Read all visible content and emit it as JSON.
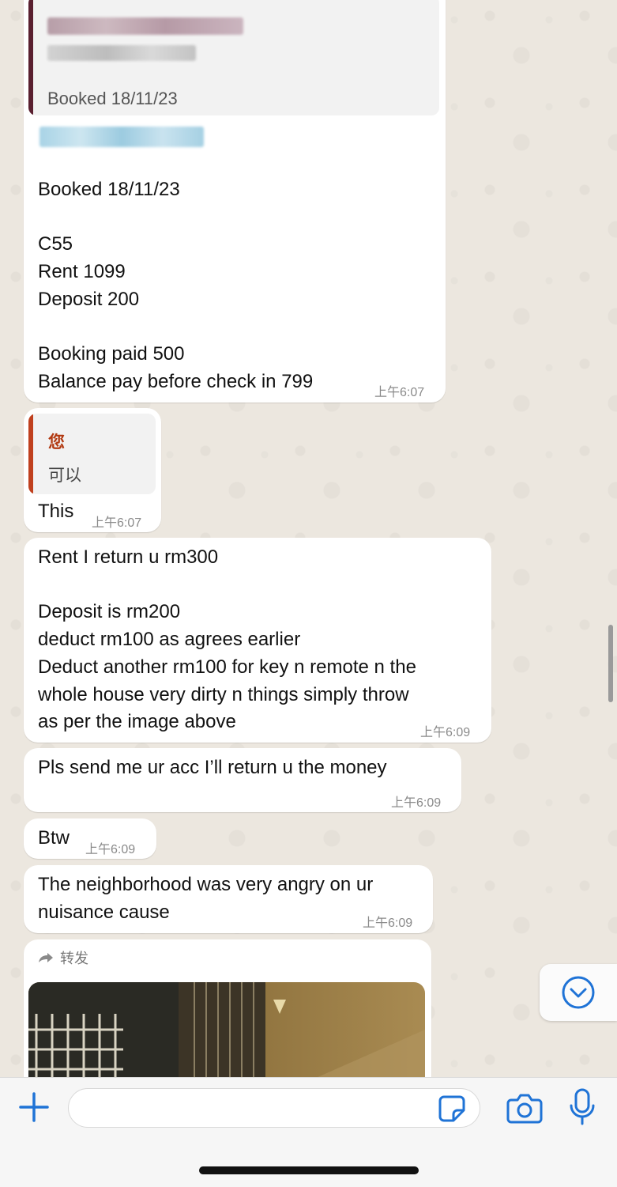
{
  "chat": {
    "messages": [
      {
        "quote": {
          "blurred_name": "▒▒▒▒▒▒ ▒▒▒▒▒",
          "blurred_line": "▒▒▒▒▒▒▒",
          "text": "Booked 18/11/23"
        },
        "blurred_header": "▒▒▒▒▒▒▒▒",
        "text": "Booked 18/11/23\n\nC55\nRent 1099\nDeposit 200\n\nBooking paid 500\nBalance pay before check in 799",
        "time": "上午6:07"
      },
      {
        "quote": {
          "author": "您",
          "text": "可以"
        },
        "text": "This",
        "time": "上午6:07"
      },
      {
        "text": "Rent I return u rm300\n\nDeposit is rm200\ndeduct rm100 as agrees earlier\nDeduct another rm100 for key n remote n the\nwhole house very dirty n things simply throw\nas per the image above",
        "time": "上午6:09"
      },
      {
        "text": "Pls send me ur acc I’ll return u the money",
        "time": "上午6:09"
      },
      {
        "text": "Btw",
        "time": "上午6:09"
      },
      {
        "text": "The neighborhood was very angry on ur\nnuisance cause",
        "time": "上午6:09"
      },
      {
        "forward_label": "转发",
        "image": "photo-of-dim-corridor-with-window-grille"
      }
    ],
    "scroll_down_icon": "chevron-down-circle-icon"
  },
  "input_bar": {
    "attach_icon": "plus-icon",
    "message_value": "",
    "sticker_icon": "sticker-icon",
    "camera_icon": "camera-icon",
    "mic_icon": "microphone-icon",
    "accent_color": "#1f73d6"
  },
  "colors": {
    "quote_bar_first": "#5a2030",
    "quote_bar_second": "#c0401e",
    "quote_author_second": "#b23a12",
    "bubble_bg": "#ffffff",
    "chat_bg": "#ece7df"
  }
}
